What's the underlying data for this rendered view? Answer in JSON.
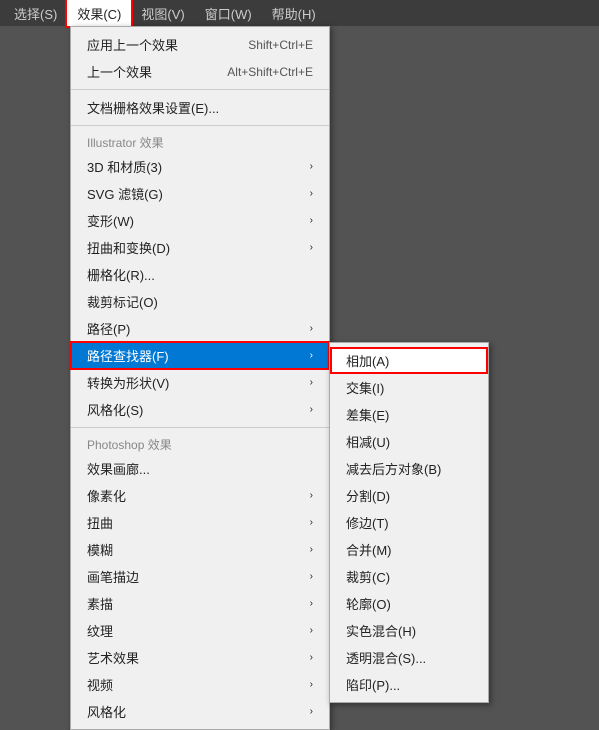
{
  "menubar": {
    "items": [
      {
        "label": "选择(S)",
        "active": false
      },
      {
        "label": "效果(C)",
        "active": true,
        "highlighted": true
      },
      {
        "label": "视图(V)",
        "active": false
      },
      {
        "label": "窗口(W)",
        "active": false
      },
      {
        "label": "帮助(H)",
        "active": false
      }
    ]
  },
  "dropdown": {
    "items": [
      {
        "label": "应用上一个效果",
        "shortcut": "Shift+Ctrl+E",
        "type": "item",
        "disabled": false
      },
      {
        "label": "上一个效果",
        "shortcut": "Alt+Shift+Ctrl+E",
        "type": "item",
        "disabled": false
      },
      {
        "type": "separator"
      },
      {
        "label": "文档栅格效果设置(E)...",
        "type": "item"
      },
      {
        "type": "separator"
      },
      {
        "label": "Illustrator 效果",
        "type": "section"
      },
      {
        "label": "3D 和材质(3)",
        "type": "item",
        "arrow": true
      },
      {
        "label": "SVG 滤镜(G)",
        "type": "item",
        "arrow": true
      },
      {
        "label": "变形(W)",
        "type": "item",
        "arrow": true
      },
      {
        "label": "扭曲和变换(D)",
        "type": "item",
        "arrow": true
      },
      {
        "label": "栅格化(R)...",
        "type": "item"
      },
      {
        "label": "裁剪标记(O)",
        "type": "item"
      },
      {
        "label": "路径(P)",
        "type": "item",
        "arrow": true
      },
      {
        "label": "路径查找器(F)",
        "type": "item",
        "arrow": true,
        "highlighted": true
      },
      {
        "label": "转换为形状(V)",
        "type": "item",
        "arrow": true
      },
      {
        "label": "风格化(S)",
        "type": "item",
        "arrow": true
      },
      {
        "type": "separator"
      },
      {
        "label": "Photoshop 效果",
        "type": "section"
      },
      {
        "label": "效果画廊...",
        "type": "item"
      },
      {
        "label": "像素化",
        "type": "item",
        "arrow": true
      },
      {
        "label": "扭曲",
        "type": "item",
        "arrow": true
      },
      {
        "label": "模糊",
        "type": "item",
        "arrow": true
      },
      {
        "label": "画笔描边",
        "type": "item",
        "arrow": true
      },
      {
        "label": "素描",
        "type": "item",
        "arrow": true
      },
      {
        "label": "纹理",
        "type": "item",
        "arrow": true
      },
      {
        "label": "艺术效果",
        "type": "item",
        "arrow": true
      },
      {
        "label": "视频",
        "type": "item",
        "arrow": true
      },
      {
        "label": "风格化",
        "type": "item",
        "arrow": true
      }
    ]
  },
  "subdropdown": {
    "items": [
      {
        "label": "相加(A)",
        "highlighted": true
      },
      {
        "label": "交集(I)"
      },
      {
        "label": "差集(E)"
      },
      {
        "label": "相减(U)"
      },
      {
        "label": "减去后方对象(B)"
      },
      {
        "label": "分割(D)"
      },
      {
        "label": "修边(T)"
      },
      {
        "label": "合并(M)"
      },
      {
        "label": "裁剪(C)"
      },
      {
        "label": "轮廓(O)"
      },
      {
        "label": "实色混合(H)"
      },
      {
        "label": "透明混合(S)..."
      },
      {
        "label": "陷印(P)..."
      }
    ]
  }
}
